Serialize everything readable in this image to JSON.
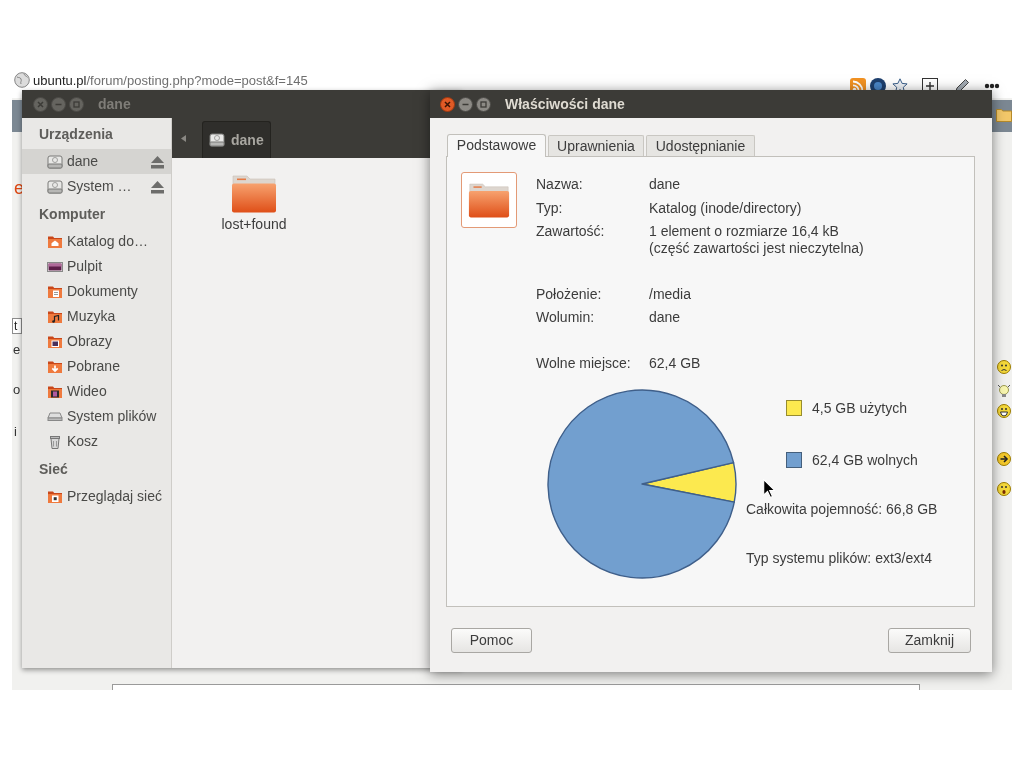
{
  "browser": {
    "address": {
      "domain": "ubuntu.pl",
      "path": "/forum/posting.php?mode=post&f=145"
    },
    "page_fragments": [
      {
        "text": "e",
        "kind": "heading"
      },
      {
        "text": "t",
        "kind": "field"
      },
      {
        "text": "e",
        "kind": "plain"
      },
      {
        "text": "o",
        "kind": "plain"
      },
      {
        "text": "i",
        "kind": "plain"
      }
    ]
  },
  "file_manager": {
    "window": {
      "title": "dane",
      "focused": false
    },
    "sidebar": {
      "sections": [
        {
          "title": "Urządzenia",
          "items": [
            {
              "label": "dane",
              "kind": "device",
              "selected": true
            },
            {
              "label": "System …",
              "kind": "device",
              "selected": false
            }
          ]
        },
        {
          "title": "Komputer",
          "items": [
            {
              "label": "Katalog do…",
              "kind": "place",
              "selected": false
            },
            {
              "label": "Pulpit",
              "kind": "place",
              "selected": false
            },
            {
              "label": "Dokumenty",
              "kind": "place",
              "selected": false
            },
            {
              "label": "Muzyka",
              "kind": "place",
              "selected": false
            },
            {
              "label": "Obrazy",
              "kind": "place",
              "selected": false
            },
            {
              "label": "Pobrane",
              "kind": "place",
              "selected": false
            },
            {
              "label": "Wideo",
              "kind": "place",
              "selected": false
            },
            {
              "label": "System plików",
              "kind": "place",
              "selected": false
            },
            {
              "label": "Kosz",
              "kind": "place",
              "selected": false
            }
          ]
        },
        {
          "title": "Sieć",
          "items": [
            {
              "label": "Przeglądaj sieć",
              "kind": "place",
              "selected": false
            }
          ]
        }
      ]
    },
    "path_bar": [
      {
        "label": "dane"
      }
    ],
    "files": [
      {
        "name": "lost+found"
      }
    ]
  },
  "properties_dialog": {
    "window": {
      "title": "Właściwości dane",
      "focused": true
    },
    "tabs": [
      {
        "label": "Podstawowe",
        "selected": true
      },
      {
        "label": "Uprawnienia",
        "selected": false
      },
      {
        "label": "Udostępnianie",
        "selected": false
      }
    ],
    "property_groups": [
      {
        "rows": [
          {
            "label": "Nazwa:",
            "value": "dane"
          },
          {
            "label": "Typ:",
            "value": "Katalog (inode/directory)"
          },
          {
            "label": "Zawartość:",
            "value": "1 element o rozmiarze 16,4 kB",
            "note": "(część zawartości jest nieczytelna)"
          }
        ]
      },
      {
        "rows": [
          {
            "label": "Położenie:",
            "value": "/media"
          },
          {
            "label": "Wolumin:",
            "value": "dane"
          }
        ]
      },
      {
        "rows": [
          {
            "label": "Wolne miejsce:",
            "value": "62,4 GB"
          }
        ]
      }
    ],
    "usage": {
      "chart_data": {
        "type": "pie",
        "categories": [
          "4,5 GB użytych",
          "62,4 GB wolnych"
        ],
        "values": [
          4.5,
          62.4
        ],
        "legend": "right"
      },
      "slices": [
        {
          "color": "#fce94f"
        },
        {
          "color": "#729fcf"
        }
      ]
    },
    "total_capacity": "Całkowita pojemność: 66,8 GB",
    "filesystem_type": "Typ systemu plików: ext3/ext4",
    "buttons": [
      {
        "label": "Pomoc"
      },
      {
        "label": "Zamknij"
      }
    ]
  }
}
